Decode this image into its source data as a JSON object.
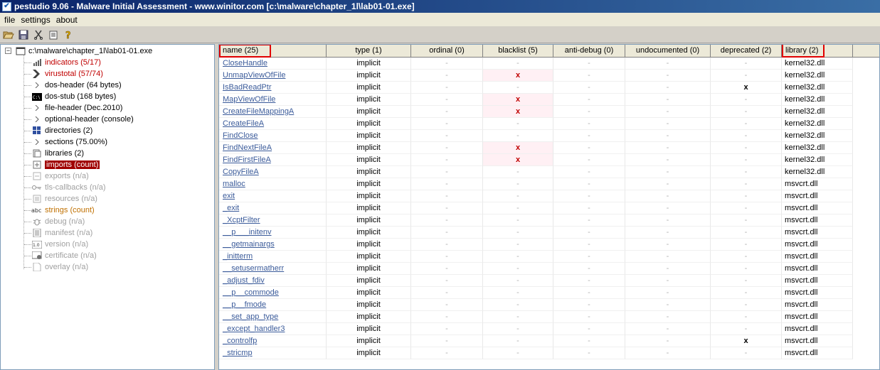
{
  "window": {
    "title": "pestudio 9.06 - Malware Initial Assessment - www.winitor.com [c:\\malware\\chapter_1l\\lab01-01.exe]"
  },
  "menu": [
    "file",
    "settings",
    "about"
  ],
  "toolbar": {
    "icons": [
      "open-folder-icon",
      "save-icon",
      "cut-icon",
      "clipboard-icon",
      "help-icon"
    ]
  },
  "tree": {
    "root": "c:\\malware\\chapter_1l\\lab01-01.exe",
    "items": [
      {
        "label": "indicators (5/17)",
        "style": "red",
        "icon": "indicators-icon"
      },
      {
        "label": "virustotal (57/74)",
        "style": "red",
        "icon": "virustotal-icon"
      },
      {
        "label": "dos-header (64 bytes)",
        "style": "normal",
        "icon": "expand-arrow-icon"
      },
      {
        "label": "dos-stub (168 bytes)",
        "style": "normal",
        "icon": "console-icon"
      },
      {
        "label": "file-header (Dec.2010)",
        "style": "normal",
        "icon": "expand-arrow-icon"
      },
      {
        "label": "optional-header (console)",
        "style": "normal",
        "icon": "expand-arrow-icon"
      },
      {
        "label": "directories (2)",
        "style": "normal",
        "icon": "directories-icon"
      },
      {
        "label": "sections (75.00%)",
        "style": "normal",
        "icon": "expand-arrow-icon"
      },
      {
        "label": "libraries (2)",
        "style": "normal",
        "icon": "libraries-icon"
      },
      {
        "label": "imports (count)",
        "style": "selected",
        "icon": "imports-icon"
      },
      {
        "label": "exports (n/a)",
        "style": "gray",
        "icon": "exports-icon"
      },
      {
        "label": "tls-callbacks (n/a)",
        "style": "gray",
        "icon": "key-icon"
      },
      {
        "label": "resources (n/a)",
        "style": "gray",
        "icon": "resources-icon"
      },
      {
        "label": "strings (count)",
        "style": "orange",
        "icon": "abc-icon"
      },
      {
        "label": "debug (n/a)",
        "style": "gray",
        "icon": "bug-icon"
      },
      {
        "label": "manifest (n/a)",
        "style": "gray",
        "icon": "manifest-icon"
      },
      {
        "label": "version (n/a)",
        "style": "gray",
        "icon": "version-icon"
      },
      {
        "label": "certificate (n/a)",
        "style": "gray",
        "icon": "certificate-icon"
      },
      {
        "label": "overlay (n/a)",
        "style": "gray",
        "icon": "overlay-icon"
      }
    ]
  },
  "table": {
    "columns": [
      "name (25)",
      "type (1)",
      "ordinal (0)",
      "blacklist (5)",
      "anti-debug (0)",
      "undocumented (0)",
      "deprecated (2)",
      "library (2)"
    ],
    "dash": "-",
    "mark": "x",
    "rows": [
      {
        "name": "CloseHandle",
        "type": "implicit",
        "blacklist": false,
        "deprecated": false,
        "library": "kernel32.dll"
      },
      {
        "name": "UnmapViewOfFile",
        "type": "implicit",
        "blacklist": true,
        "deprecated": false,
        "library": "kernel32.dll"
      },
      {
        "name": "IsBadReadPtr",
        "type": "implicit",
        "blacklist": false,
        "deprecated": true,
        "library": "kernel32.dll"
      },
      {
        "name": "MapViewOfFile",
        "type": "implicit",
        "blacklist": true,
        "deprecated": false,
        "library": "kernel32.dll"
      },
      {
        "name": "CreateFileMappingA",
        "type": "implicit",
        "blacklist": true,
        "deprecated": false,
        "library": "kernel32.dll"
      },
      {
        "name": "CreateFileA",
        "type": "implicit",
        "blacklist": false,
        "deprecated": false,
        "library": "kernel32.dll"
      },
      {
        "name": "FindClose",
        "type": "implicit",
        "blacklist": false,
        "deprecated": false,
        "library": "kernel32.dll"
      },
      {
        "name": "FindNextFileA",
        "type": "implicit",
        "blacklist": true,
        "deprecated": false,
        "library": "kernel32.dll"
      },
      {
        "name": "FindFirstFileA",
        "type": "implicit",
        "blacklist": true,
        "deprecated": false,
        "library": "kernel32.dll"
      },
      {
        "name": "CopyFileA",
        "type": "implicit",
        "blacklist": false,
        "deprecated": false,
        "library": "kernel32.dll"
      },
      {
        "name": "malloc",
        "type": "implicit",
        "blacklist": false,
        "deprecated": false,
        "library": "msvcrt.dll"
      },
      {
        "name": "exit",
        "type": "implicit",
        "blacklist": false,
        "deprecated": false,
        "library": "msvcrt.dll"
      },
      {
        "name": "_exit",
        "type": "implicit",
        "blacklist": false,
        "deprecated": false,
        "library": "msvcrt.dll"
      },
      {
        "name": "_XcptFilter",
        "type": "implicit",
        "blacklist": false,
        "deprecated": false,
        "library": "msvcrt.dll"
      },
      {
        "name": "__p___initenv",
        "type": "implicit",
        "blacklist": false,
        "deprecated": false,
        "library": "msvcrt.dll"
      },
      {
        "name": "__getmainargs",
        "type": "implicit",
        "blacklist": false,
        "deprecated": false,
        "library": "msvcrt.dll"
      },
      {
        "name": "_initterm",
        "type": "implicit",
        "blacklist": false,
        "deprecated": false,
        "library": "msvcrt.dll"
      },
      {
        "name": "__setusermatherr",
        "type": "implicit",
        "blacklist": false,
        "deprecated": false,
        "library": "msvcrt.dll"
      },
      {
        "name": "_adjust_fdiv",
        "type": "implicit",
        "blacklist": false,
        "deprecated": false,
        "library": "msvcrt.dll"
      },
      {
        "name": "__p__commode",
        "type": "implicit",
        "blacklist": false,
        "deprecated": false,
        "library": "msvcrt.dll"
      },
      {
        "name": "__p__fmode",
        "type": "implicit",
        "blacklist": false,
        "deprecated": false,
        "library": "msvcrt.dll"
      },
      {
        "name": "__set_app_type",
        "type": "implicit",
        "blacklist": false,
        "deprecated": false,
        "library": "msvcrt.dll"
      },
      {
        "name": "_except_handler3",
        "type": "implicit",
        "blacklist": false,
        "deprecated": false,
        "library": "msvcrt.dll"
      },
      {
        "name": "_controlfp",
        "type": "implicit",
        "blacklist": false,
        "deprecated": true,
        "library": "msvcrt.dll"
      },
      {
        "name": "_stricmp",
        "type": "implicit",
        "blacklist": false,
        "deprecated": false,
        "library": "msvcrt.dll"
      }
    ]
  },
  "colors": {
    "highlight_box": "#e00000",
    "selected_tree_item": "#a00000",
    "blacklist_hit_bg": "#fff0f4"
  }
}
